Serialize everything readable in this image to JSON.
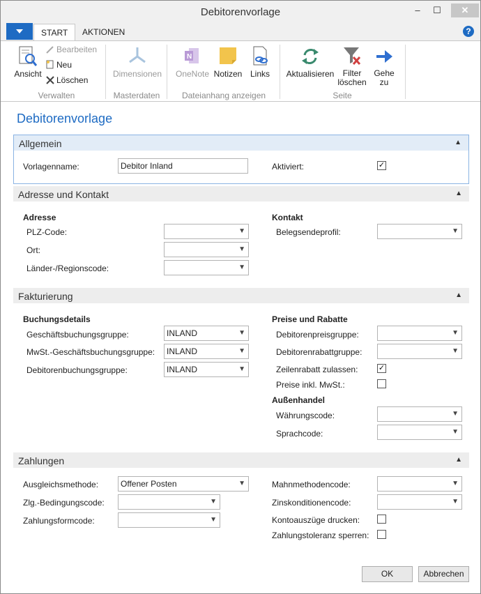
{
  "window": {
    "title": "Debitorenvorlage",
    "min": "–",
    "max": "☐",
    "close": "✕"
  },
  "ribbon": {
    "tabs": [
      {
        "label": "START"
      },
      {
        "label": "AKTIONEN"
      }
    ],
    "help": "?",
    "groups": {
      "verwalten": {
        "label": "Verwalten",
        "ansicht": "Ansicht",
        "bearbeiten": "Bearbeiten",
        "neu": "Neu",
        "loeschen": "Löschen"
      },
      "masterdaten": {
        "label": "Masterdaten",
        "dimensionen": "Dimensionen"
      },
      "dateianhang": {
        "label": "Dateianhang anzeigen",
        "onenote": "OneNote",
        "notizen": "Notizen",
        "links": "Links"
      },
      "seite": {
        "label": "Seite",
        "aktualisieren": "Aktualisieren",
        "filter_1": "Filter",
        "filter_2": "löschen",
        "gehe_1": "Gehe",
        "gehe_2": "zu"
      }
    },
    "colors": {
      "accent": "#1e6bc3",
      "refresh": "#3a8a6e",
      "onenote": "#9b6fc0",
      "notes": "#f2c44c",
      "arrow": "#2f6fd0",
      "filter_x": "#d04040"
    }
  },
  "page": {
    "title": "Debitorenvorlage"
  },
  "sections": {
    "allgemein": {
      "title": "Allgemein",
      "vorlagenname_label": "Vorlagenname:",
      "vorlagenname_value": "Debitor Inland",
      "aktiviert_label": "Aktiviert:",
      "aktiviert_checked": "✓"
    },
    "adresse": {
      "title": "Adresse und Kontakt",
      "adresse_head": "Adresse",
      "plz_label": "PLZ-Code:",
      "plz_value": "",
      "ort_label": "Ort:",
      "ort_value": "",
      "land_label": "Länder-/Regionscode:",
      "land_value": "",
      "kontakt_head": "Kontakt",
      "belegsende_label": "Belegsendeprofil:",
      "belegsende_value": ""
    },
    "fakturierung": {
      "title": "Fakturierung",
      "buchung_head": "Buchungsdetails",
      "gesch_label": "Geschäftsbuchungsgruppe:",
      "gesch_value": "INLAND",
      "mwst_label": "MwSt.-Geschäftsbuchungsgruppe:",
      "mwst_value": "INLAND",
      "deb_label": "Debitorenbuchungsgruppe:",
      "deb_value": "INLAND",
      "preise_head": "Preise und Rabatte",
      "preisgr_label": "Debitorenpreisgruppe:",
      "preisgr_value": "",
      "rabatt_label": "Debitorenrabattgruppe:",
      "rabatt_value": "",
      "zeilen_label": "Zeilenrabatt zulassen:",
      "zeilen_checked": "✓",
      "inkl_label": "Preise inkl. MwSt.:",
      "inkl_checked": "",
      "aussen_head": "Außenhandel",
      "waehrung_label": "Währungscode:",
      "waehrung_value": "",
      "sprach_label": "Sprachcode:",
      "sprach_value": ""
    },
    "zahlungen": {
      "title": "Zahlungen",
      "ausgleich_label": "Ausgleichsmethode:",
      "ausgleich_value": "Offener Posten",
      "zlg_label": "Zlg.-Bedingungscode:",
      "zlg_value": "",
      "form_label": "Zahlungsformcode:",
      "form_value": "",
      "mahn_label": "Mahnmethodencode:",
      "mahn_value": "",
      "zins_label": "Zinskonditionencode:",
      "zins_value": "",
      "konto_label": "Kontoauszüge drucken:",
      "konto_checked": "",
      "toleranz_label": "Zahlungstoleranz sperren:",
      "toleranz_checked": ""
    }
  },
  "footer": {
    "ok": "OK",
    "cancel": "Abbrechen"
  },
  "icons": {
    "chevron_up": "▲",
    "dropdown": "▼"
  }
}
